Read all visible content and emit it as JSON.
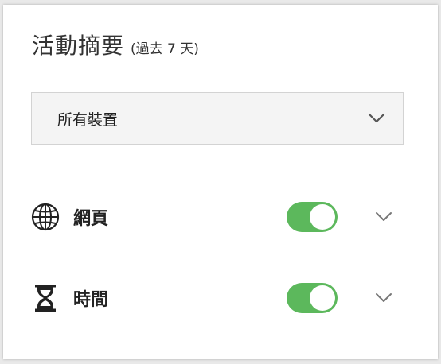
{
  "header": {
    "title": "活動摘要",
    "subtitle": "(過去 7 天)"
  },
  "device_select": {
    "value": "所有裝置",
    "icon": "chevron-down-icon"
  },
  "sections": [
    {
      "label": "網頁",
      "icon": "globe-icon",
      "enabled": true
    },
    {
      "label": "時間",
      "icon": "hourglass-icon",
      "enabled": true
    }
  ],
  "colors": {
    "toggle_on": "#5cb85c",
    "divider": "#dcdcdc"
  }
}
